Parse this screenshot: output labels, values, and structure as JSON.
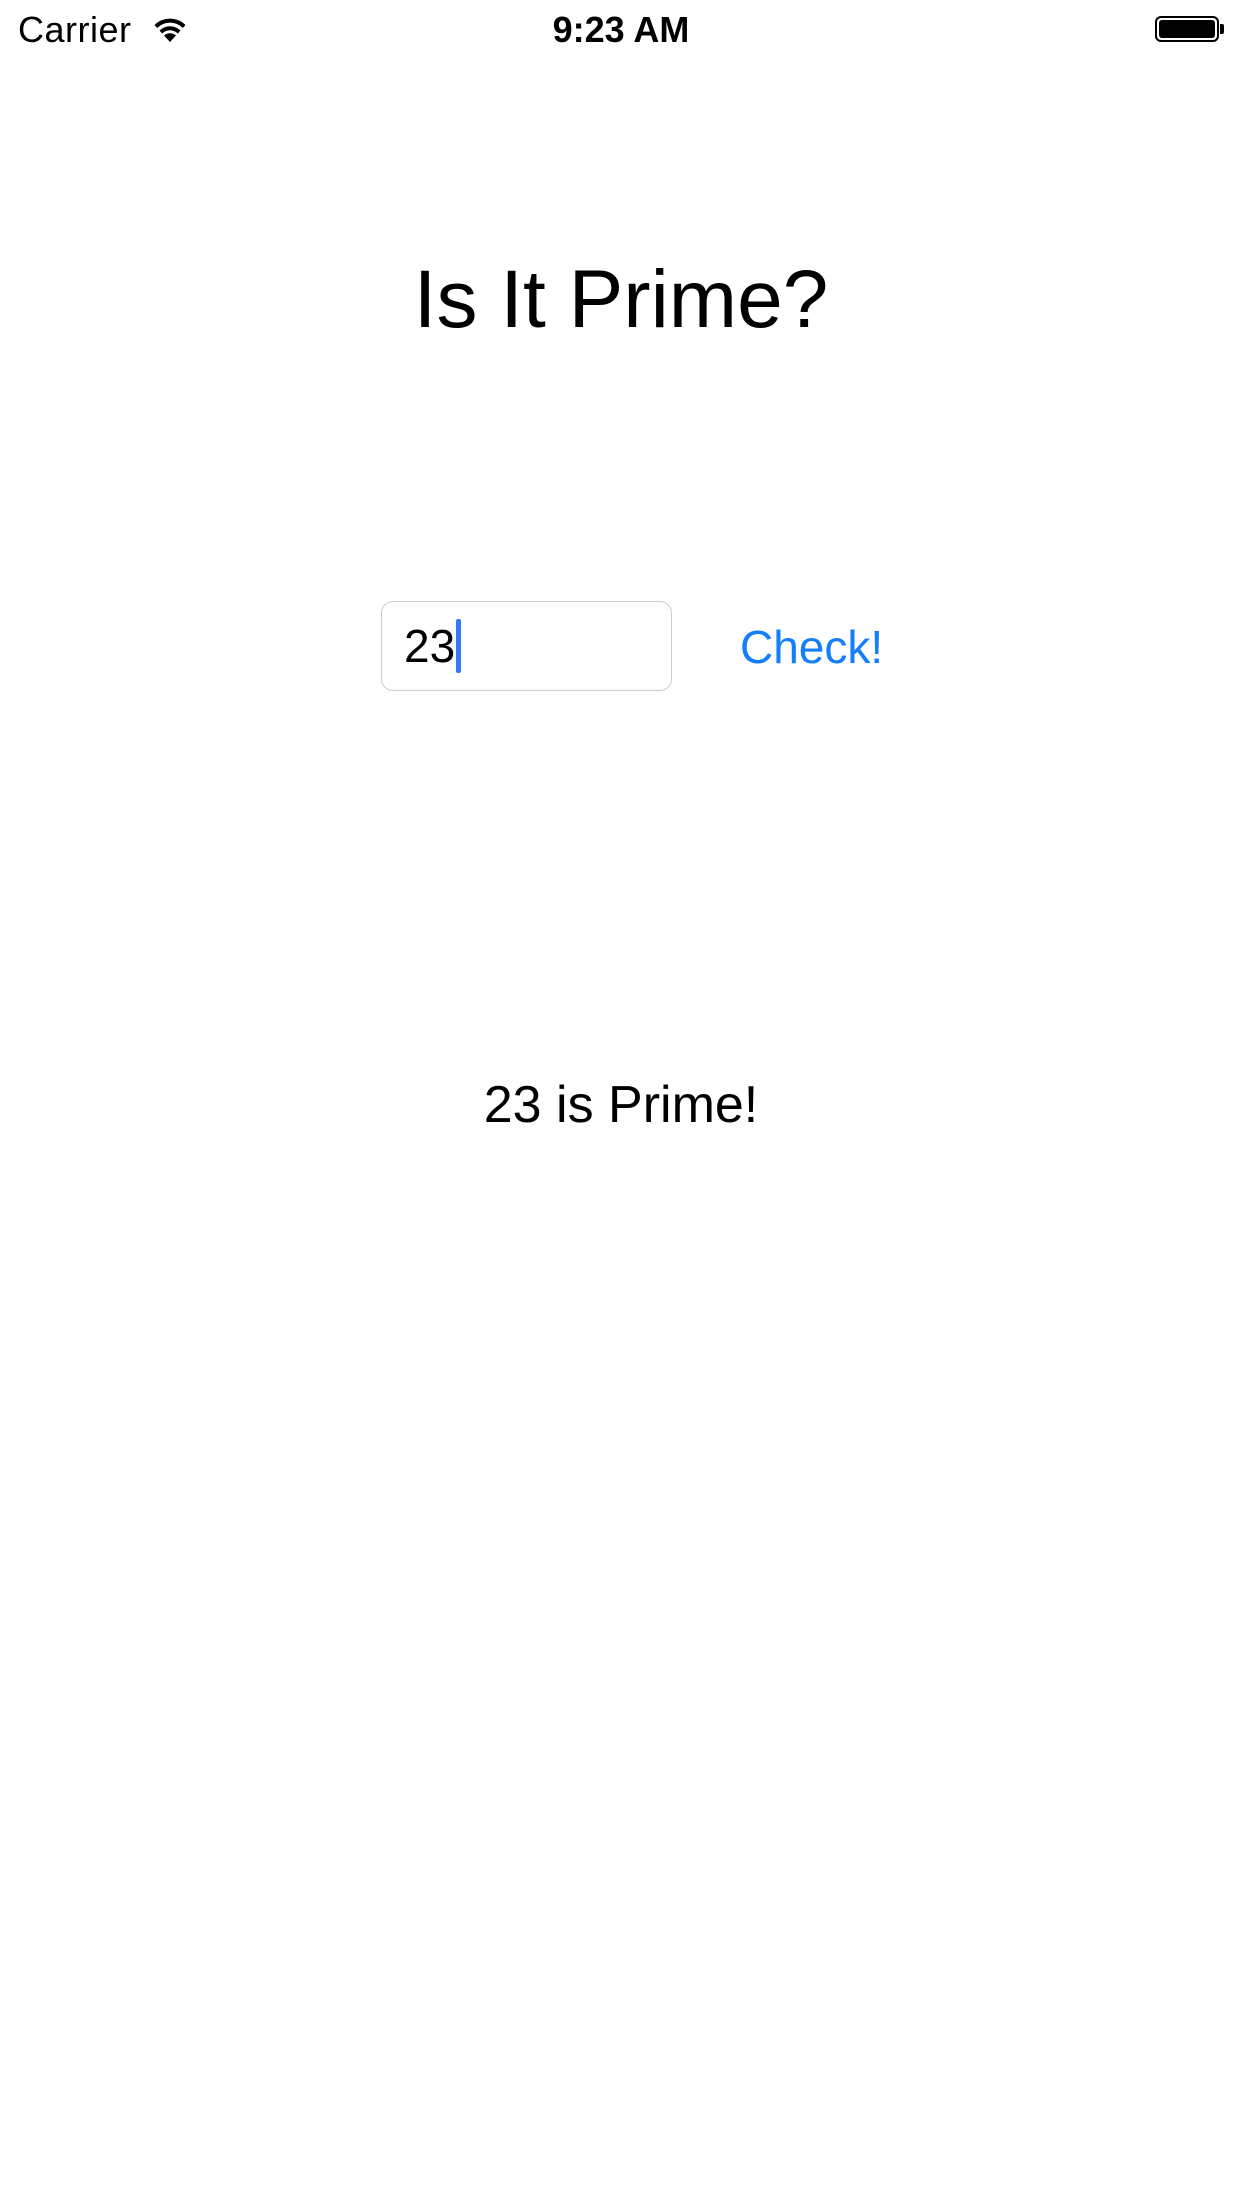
{
  "status_bar": {
    "carrier": "Carrier",
    "time": "9:23 AM",
    "wifi_icon": "wifi-icon",
    "battery_icon": "battery-full-icon",
    "battery_level": 1.0
  },
  "app": {
    "title": "Is It Prime?",
    "input": {
      "value": "23"
    },
    "check_button_label": "Check!",
    "result_text": "23 is Prime!"
  },
  "colors": {
    "accent": "#147efb",
    "caret": "#3478f6",
    "text": "#000000",
    "background": "#ffffff",
    "field_border": "#cccccc"
  }
}
